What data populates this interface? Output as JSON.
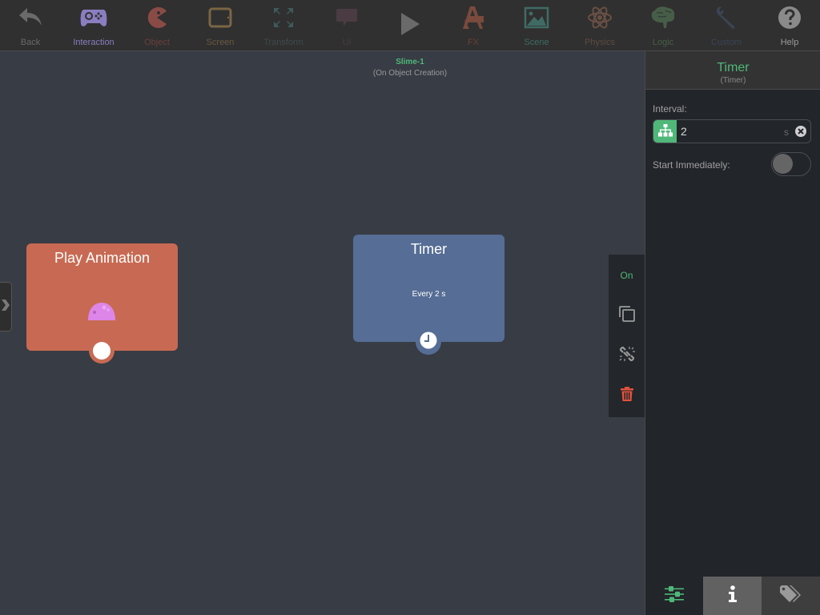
{
  "toolbar": {
    "items": [
      {
        "label": "Back",
        "icon": "back-arrow-icon",
        "color": "#6a6a6a"
      },
      {
        "label": "Interaction",
        "icon": "gamepad-icon",
        "color": "#8a7ec0"
      },
      {
        "label": "Object",
        "icon": "pacman-icon",
        "color": "#8a4b46"
      },
      {
        "label": "Screen",
        "icon": "tablet-icon",
        "color": "#7a6545"
      },
      {
        "label": "Transform",
        "icon": "expand-arrows-icon",
        "color": "#3f5a5a"
      },
      {
        "label": "UI",
        "icon": "speech-bubble-icon",
        "color": "#4a3c42"
      },
      {
        "label": "FX",
        "icon": "paint-ruler-icon",
        "color": "#7a4a3c"
      },
      {
        "label": "Scene",
        "icon": "image-icon",
        "color": "#3f6b64"
      },
      {
        "label": "Physics",
        "icon": "atom-icon",
        "color": "#6a5045"
      },
      {
        "label": "Logic",
        "icon": "brain-icon",
        "color": "#465e48"
      },
      {
        "label": "Custom",
        "icon": "wrench-icon",
        "color": "#3c4455"
      },
      {
        "label": "Help",
        "icon": "help-icon",
        "color": "#8a8a8a"
      }
    ],
    "play_icon": "play-icon"
  },
  "canvas": {
    "object_name": "Slime-1",
    "event_name": "(On Object Creation)",
    "nodes": [
      {
        "title": "Play Animation",
        "color": "#c86a53",
        "icon": "slime-icon"
      },
      {
        "title": "Timer",
        "subtitle": "Every 2 s",
        "color": "#566d95",
        "icon": "clock-icon"
      }
    ]
  },
  "action_bar": {
    "on_label": "On",
    "items": [
      "copy-icon",
      "unlink-icon",
      "trash-icon"
    ]
  },
  "panel": {
    "title": "Timer",
    "subtitle": "(Timer)",
    "interval_label": "Interval:",
    "interval_value": "2",
    "interval_unit": "s",
    "start_immediately_label": "Start Immediately:",
    "start_immediately": false,
    "accent": "#4fb879",
    "tabs": [
      "sliders-icon",
      "info-icon",
      "tags-icon"
    ]
  }
}
